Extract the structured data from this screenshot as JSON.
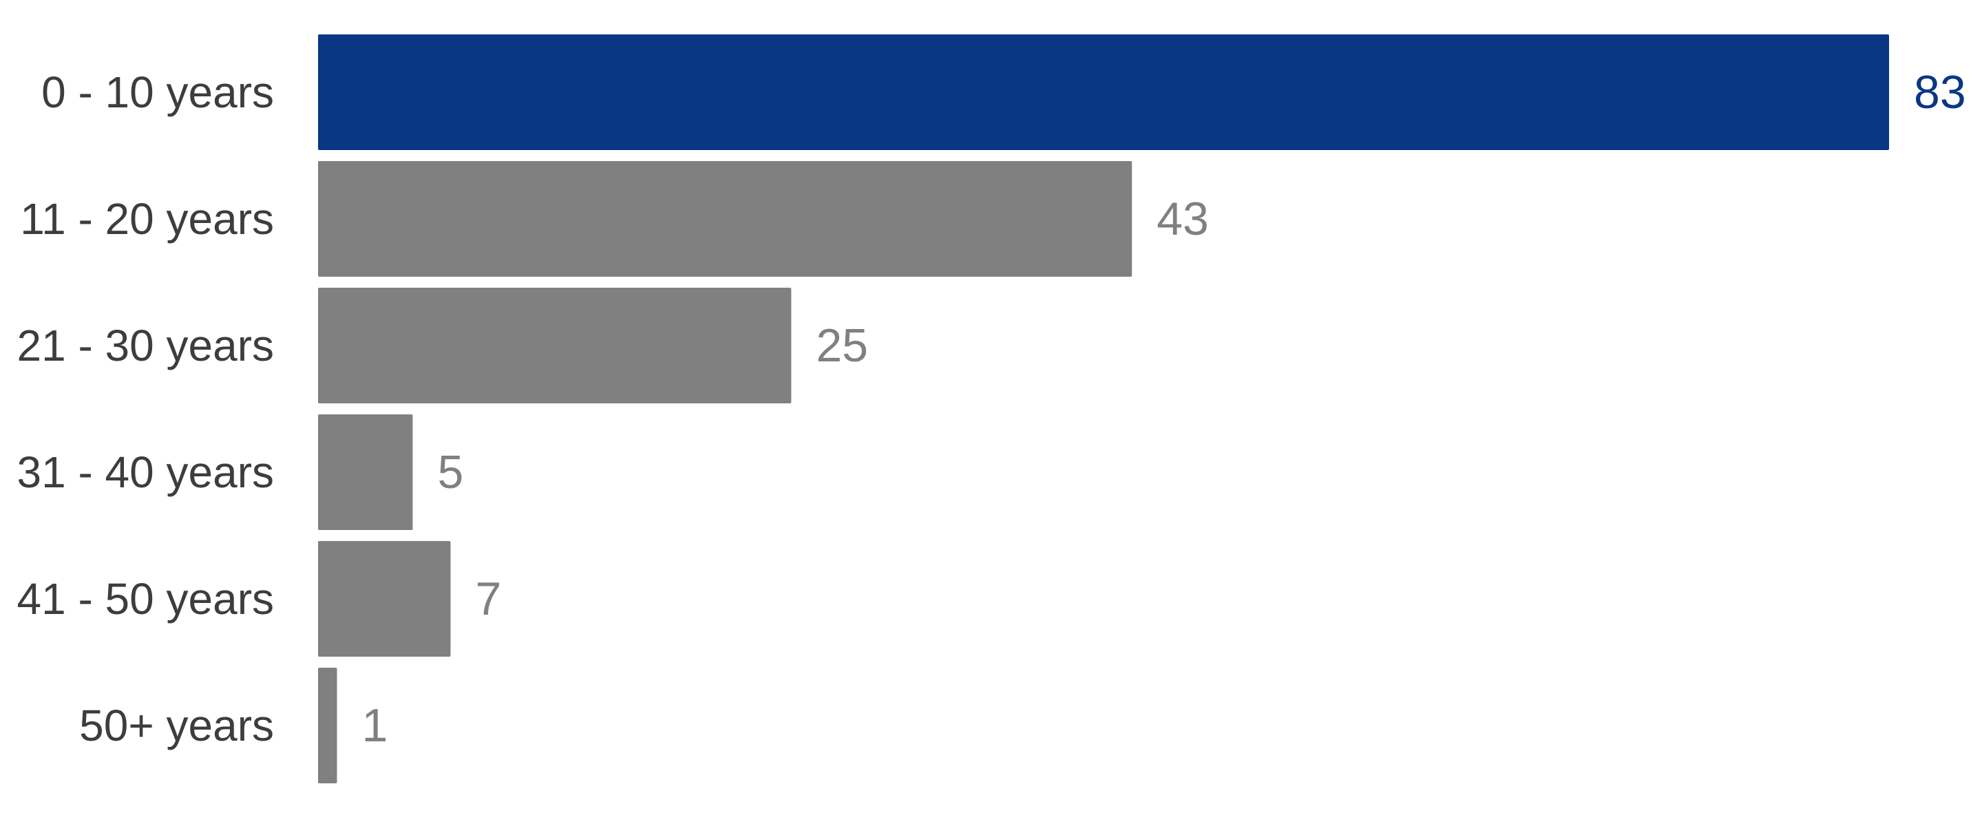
{
  "chart_data": {
    "type": "bar",
    "orientation": "horizontal",
    "categories": [
      "0 - 10 years",
      "11 - 20 years",
      "21 - 30 years",
      "31 - 40 years",
      "41 - 50 years",
      "50+ years"
    ],
    "values": [
      83,
      43,
      25,
      5,
      7,
      1
    ],
    "highlight_index": 0,
    "xlim": [
      0,
      83
    ],
    "grid": false,
    "legend": "none",
    "title": "",
    "xlabel": "",
    "ylabel": ""
  },
  "colors": {
    "highlight": "#0a3783",
    "bar": "#808080",
    "category_label": "#3d3d3d",
    "value_label_default": "#808080",
    "value_label_highlight": "#0a3783"
  }
}
